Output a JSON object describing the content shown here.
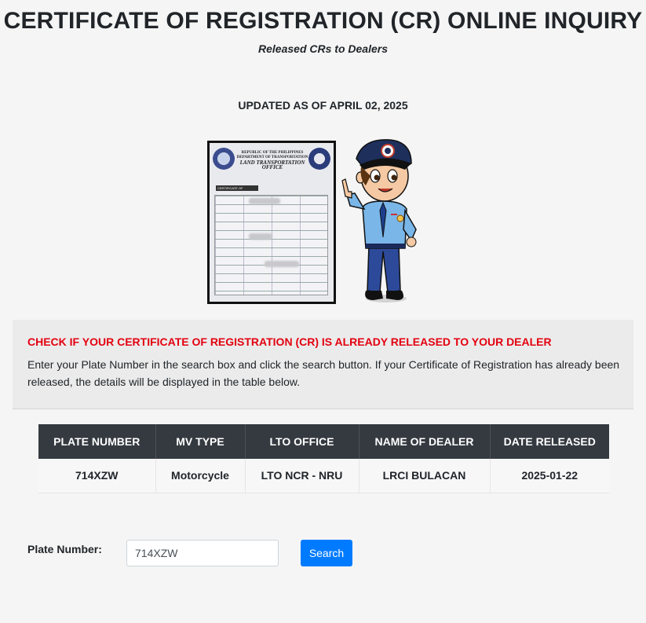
{
  "page": {
    "title": "CERTIFICATE OF REGISTRATION (CR) ONLINE INQUIRY",
    "subtitle": "Released CRs to Dealers",
    "updated": "UPDATED AS OF APRIL 02, 2025"
  },
  "hero": {
    "document": {
      "header_line1": "REPUBLIC OF THE PHILIPPINES",
      "header_line2": "DEPARTMENT OF TRANSPORTATION",
      "header_line3": "LAND TRANSPORTATION OFFICE",
      "tag": "CERTIFICATE OF REGISTRATION"
    }
  },
  "report": {
    "heading": "CHECK IF YOUR CERTIFICATE OF REGISTRATION (CR) IS ALREADY RELEASED TO YOUR DEALER",
    "instructions": "Enter your Plate Number in the search box and click the search button. If your Certificate of Registration has already been released, the details will be displayed in the table below."
  },
  "table": {
    "headers": [
      "PLATE NUMBER",
      "MV TYPE",
      "LTO OFFICE",
      "NAME OF DEALER",
      "DATE RELEASED"
    ],
    "rows": [
      [
        "714XZW",
        "Motorcycle",
        "LTO NCR - NRU",
        "LRCI BULACAN",
        "2025-01-22"
      ]
    ]
  },
  "search": {
    "label": "Plate Number:",
    "value": "714XZW",
    "button_label": "Search"
  },
  "colors": {
    "accent_red": "#e3000f",
    "button_blue": "#007bff",
    "table_header": "#343a40"
  }
}
